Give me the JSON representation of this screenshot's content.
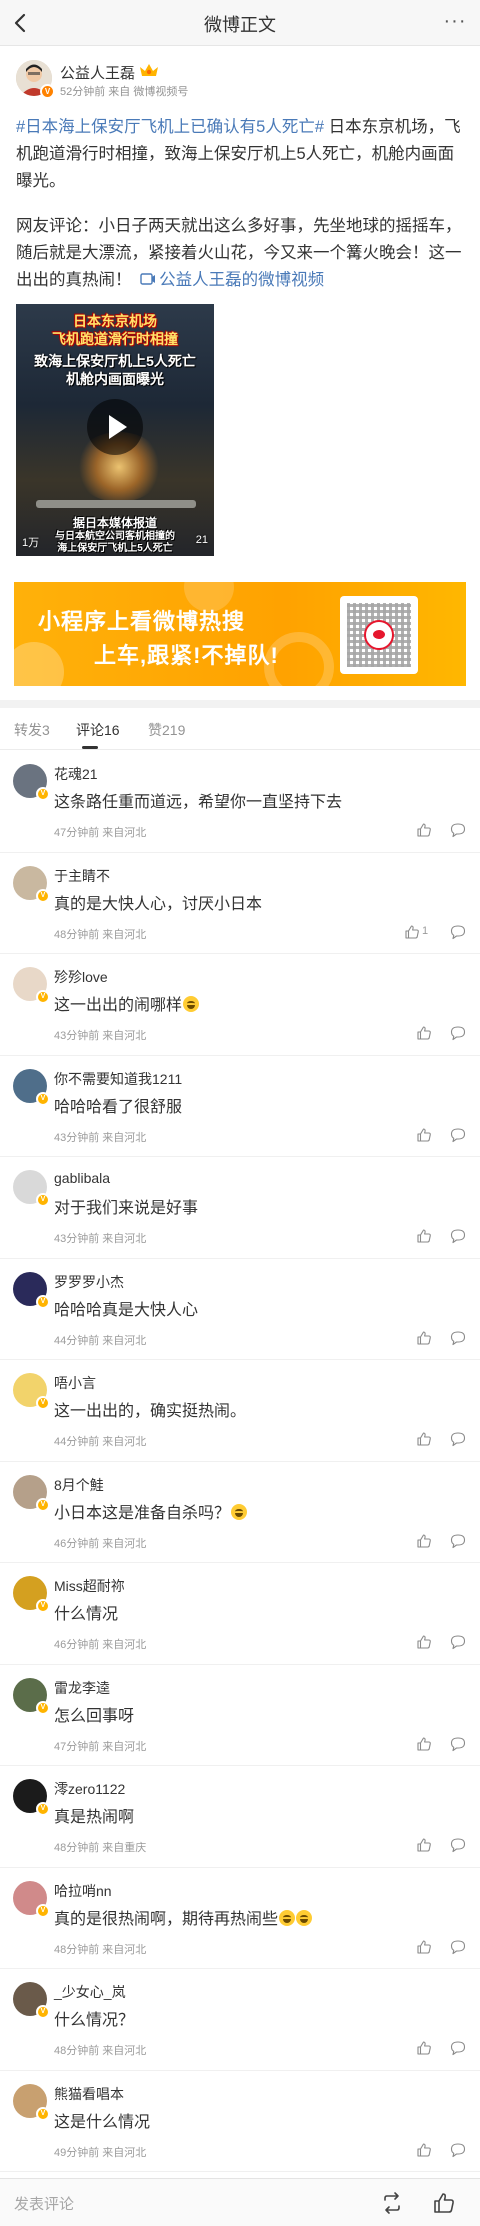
{
  "nav": {
    "title": "微博正文",
    "more": "···"
  },
  "post": {
    "author": "公益人王磊",
    "meta": "52分钟前 来自 微博视频号",
    "topic": "#日本海上保安厅飞机上已确认有5人死亡#",
    "body1": " 日本东京机场，飞机跑道滑行时相撞，致海上保安厅机上5人死亡，机舱内画面曝光。",
    "body2": "网友评论：小日子两天就出这么多好事，先坐地球的摇摇车，随后就是大漂流，紧接着火山花，今又来一个篝火晚会！这一出出的真热闹！",
    "link_text": "公益人王磊的微博视频",
    "video": {
      "title_line1": "日本东京机场",
      "title_line2": "飞机跑道滑行时相撞",
      "title_line3": "致海上保安厅机上5人死亡",
      "title_line4": "机舱内画面曝光",
      "sub_line1": "据日本媒体报道",
      "sub_line2": "与日本航空公司客机相撞的",
      "sub_line3": "海上保安厅飞机上5人死亡",
      "views": "1万",
      "duration": "21"
    }
  },
  "banner": {
    "line1": "小程序上看微博热搜",
    "line2": "上车,跟紧!不掉队!"
  },
  "tabs": {
    "repost": "转发3",
    "comment": "评论16",
    "like": "赞219"
  },
  "comments": [
    {
      "name": "花魂21",
      "text": "这条路任重而道远，希望你一直坚持下去",
      "meta": "47分钟前 来自河北",
      "likes": "",
      "emoji": false,
      "avatar_color": "#6a7380"
    },
    {
      "name": "于主睛不",
      "text": "真的是大快人心，讨厌小日本",
      "meta": "48分钟前 来自河北",
      "likes": "1",
      "emoji": false,
      "avatar_color": "#c9b8a0"
    },
    {
      "name": "殄殄love",
      "text": "这一出出的闹哪样",
      "meta": "43分钟前 来自河北",
      "likes": "",
      "emoji": true,
      "avatar_color": "#e8d8c8"
    },
    {
      "name": "你不需要知道我1211",
      "text": "哈哈哈看了很舒服",
      "meta": "43分钟前 来自河北",
      "likes": "",
      "emoji": false,
      "avatar_color": "#4f6e8a"
    },
    {
      "name": "gablibala",
      "text": "对于我们来说是好事",
      "meta": "43分钟前 来自河北",
      "likes": "",
      "emoji": false,
      "avatar_color": "#d9d9d9"
    },
    {
      "name": "罗罗罗小杰",
      "text": "哈哈哈真是大快人心",
      "meta": "44分钟前 来自河北",
      "likes": "",
      "emoji": false,
      "avatar_color": "#2a2a5a"
    },
    {
      "name": "唔小言",
      "text": "这一出出的，确实挺热闹。",
      "meta": "44分钟前 来自河北",
      "likes": "",
      "emoji": false,
      "avatar_color": "#f2d36b"
    },
    {
      "name": "8月个鮭",
      "text": "小日本这是准备自杀吗？",
      "meta": "46分钟前 来自河北",
      "likes": "",
      "emoji": true,
      "avatar_color": "#b5a08a"
    },
    {
      "name": "Miss超耐祢",
      "text": "什么情况",
      "meta": "46分钟前 来自河北",
      "likes": "",
      "emoji": false,
      "avatar_color": "#d4a020"
    },
    {
      "name": "雷龙李逵",
      "text": "怎么回事呀",
      "meta": "47分钟前 来自河北",
      "likes": "",
      "emoji": false,
      "avatar_color": "#5b6d4a"
    },
    {
      "name": "澪zero1122",
      "text": "真是热闹啊",
      "meta": "48分钟前 来自重庆",
      "likes": "",
      "emoji": false,
      "avatar_color": "#1b1b1b"
    },
    {
      "name": "哈拉哨nn",
      "text": "真的是很热闹啊，期待再热闹些",
      "meta": "48分钟前 来自河北",
      "likes": "",
      "emoji": true,
      "emoji_count": 2,
      "avatar_color": "#d08a8a"
    },
    {
      "name": "_少女心_岚",
      "text": "什么情况？",
      "meta": "48分钟前 来自河北",
      "likes": "",
      "emoji": false,
      "avatar_color": "#6a5a4a"
    },
    {
      "name": "熊猫看唱本",
      "text": "这是什么情况",
      "meta": "49分钟前 来自河北",
      "likes": "",
      "emoji": false,
      "avatar_color": "#c8a070"
    }
  ],
  "footer": {
    "placeholder": "发表评论"
  }
}
